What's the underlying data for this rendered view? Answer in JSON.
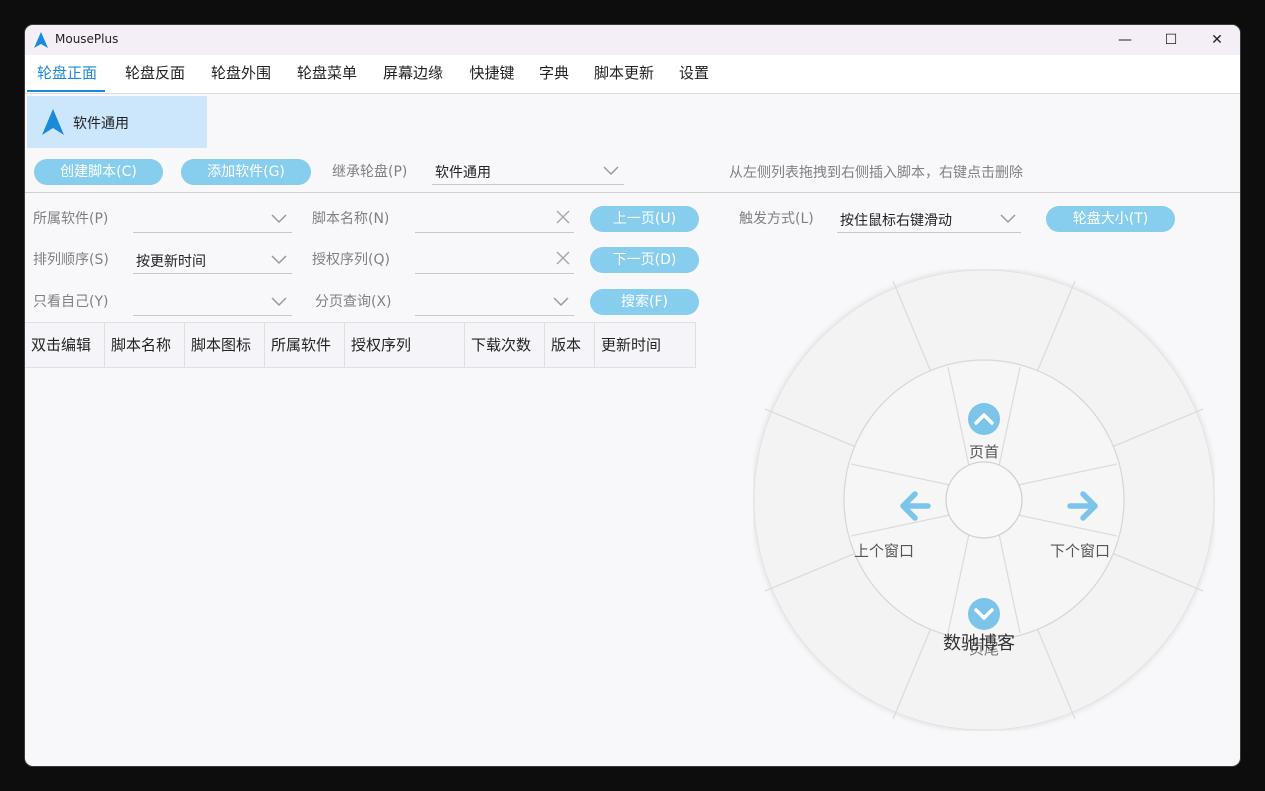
{
  "app": {
    "title": "MousePlus"
  },
  "window_controls": {
    "minimize": "—",
    "maximize": "☐",
    "close": "✕"
  },
  "tabs": [
    "轮盘正面",
    "轮盘反面",
    "轮盘外围",
    "轮盘菜单",
    "屏幕边缘",
    "快捷键",
    "字典",
    "脚本更新",
    "设置"
  ],
  "active_tab": "轮盘正面",
  "software_list": [
    {
      "label": "软件通用",
      "icon": "navigation-arrow-icon"
    }
  ],
  "toolbar": {
    "create_script": "创建脚本(C)",
    "add_software": "添加软件(G)",
    "inherit_label": "继承轮盘(P)",
    "inherit_value": "软件通用",
    "hint": "从左侧列表拖拽到右侧插入脚本，右键点击删除"
  },
  "filters": {
    "software_label": "所属软件(P)",
    "software_value": "",
    "script_name_label": "脚本名称(N)",
    "script_name_value": "",
    "prev_page": "上一页(U)",
    "sort_label": "排列顺序(S)",
    "sort_value": "按更新时间",
    "auth_label": "授权序列(Q)",
    "auth_value": "",
    "next_page": "下一页(D)",
    "mine_label": "只看自己(Y)",
    "mine_value": "",
    "page_label": "分页查询(X)",
    "page_value": "",
    "search": "搜索(F)"
  },
  "trigger": {
    "label": "触发方式(L)",
    "value": "按住鼠标右键滑动",
    "size_button": "轮盘大小(T)"
  },
  "table": {
    "headers": [
      "双击编辑",
      "脚本名称",
      "脚本图标",
      "所属软件",
      "授权序列",
      "下载次数",
      "版本",
      "更新时间"
    ],
    "rows": []
  },
  "wheel": {
    "top": {
      "label": "页首",
      "icon": "chevron-up-circle-icon"
    },
    "left": {
      "label": "上个窗口",
      "icon": "arrow-left-icon"
    },
    "right": {
      "label": "下个窗口",
      "icon": "arrow-right-icon"
    },
    "bottom": {
      "label": "页尾",
      "icon": "chevron-down-circle-icon"
    },
    "bottom_overlay": "数驰博客"
  },
  "colors": {
    "accent": "#1a8ad9",
    "button": "#86cdee",
    "selected_bg": "#cce7fb",
    "icon_blue": "#7cc4ea"
  }
}
